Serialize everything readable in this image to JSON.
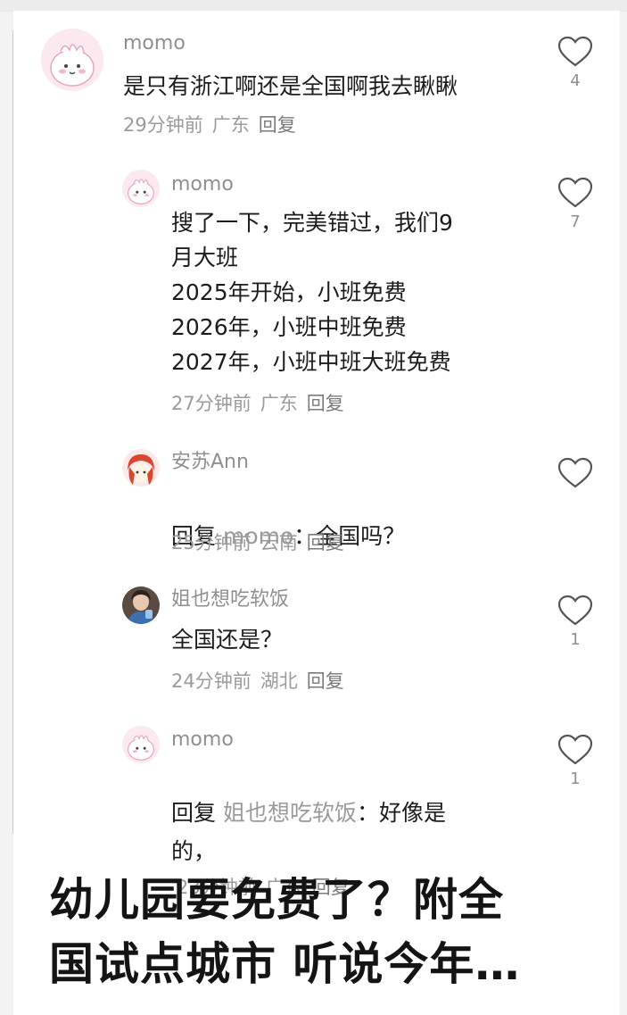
{
  "comments": [
    {
      "user": "momo",
      "text": "是只有浙江啊还是全国啊我去瞅瞅",
      "time": "29分钟前",
      "region": "广东",
      "reply": "回复",
      "likes": "4",
      "avatar_icon": "pink-bunny-avatar"
    },
    {
      "user": "momo",
      "text": "搜了一下，完美错过，我们9\n月大班\n2025年开始，小班免费\n2026年，小班中班免费\n2027年，小班中班大班免费",
      "time": "27分钟前",
      "region": "广东",
      "reply": "回复",
      "likes": "7",
      "avatar_icon": "pink-bunny-avatar"
    },
    {
      "user": "安苏Ann",
      "reply_prefix": "回复",
      "reply_target": "momo",
      "text": "：全国吗？",
      "time": "25分钟前",
      "region": "云南",
      "reply": "回复",
      "avatar_icon": "cartoon-girl-avatar"
    },
    {
      "user": "姐也想吃软饭",
      "text": "全国还是？",
      "time": "24分钟前",
      "region": "湖北",
      "reply": "回复",
      "likes": "1",
      "avatar_icon": "photo-portrait-avatar"
    },
    {
      "user": "momo",
      "reply_prefix": "回复",
      "reply_target": "姐也想吃软饭",
      "text_line1": "：好像是",
      "text_line2": "的，",
      "time": "23分钟前",
      "region": "广东",
      "reply": "回复",
      "likes": "1",
      "avatar_icon": "pink-bunny-avatar"
    }
  ],
  "headline": "幼儿园要免费了？附全\n国试点城市 听说今年…",
  "colors": {
    "username": "#8f8f8f",
    "meta": "#9a9a9a",
    "text": "#1c1c1c",
    "heart_outline": "#555555",
    "avatar_bg": "#fbe9ef"
  }
}
